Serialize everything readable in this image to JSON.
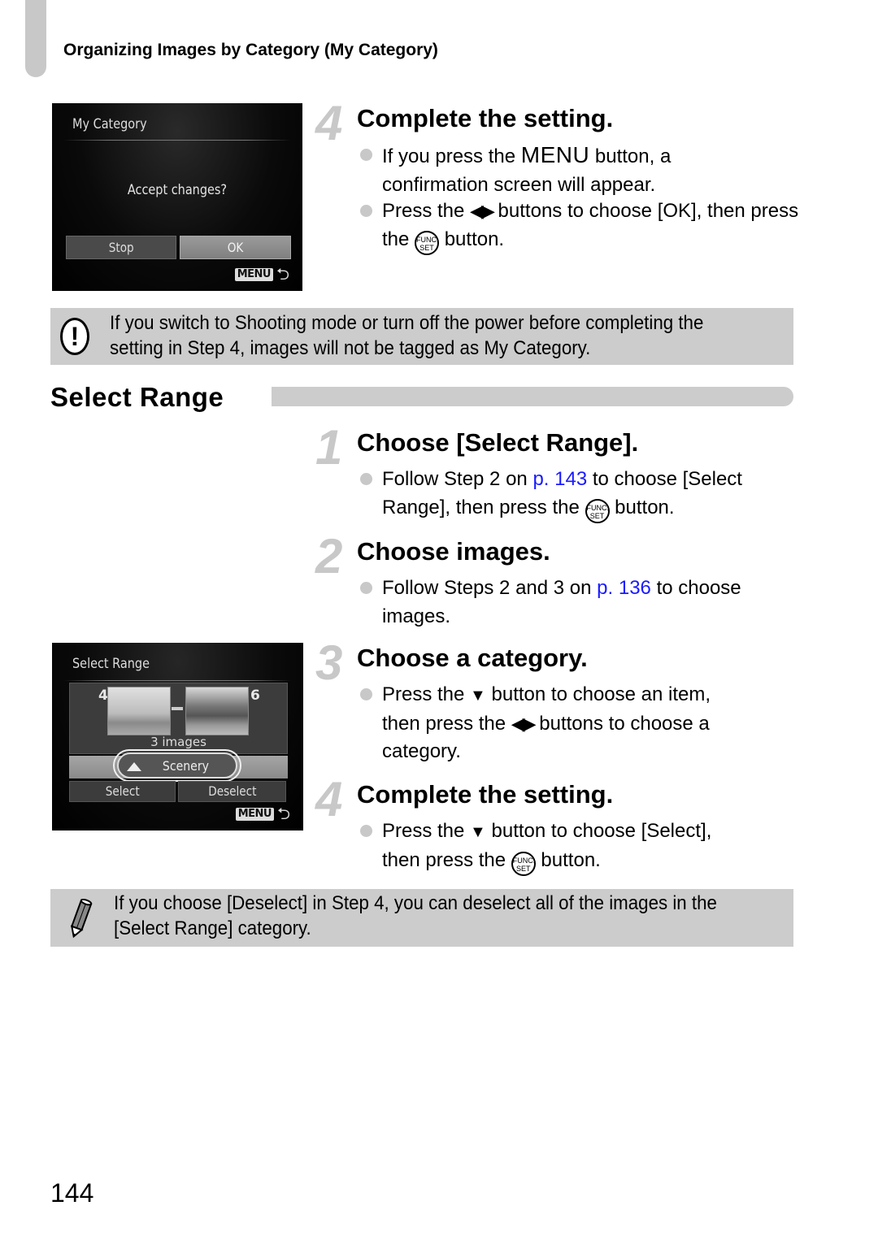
{
  "running_head": "Organizing Images by Category (My Category)",
  "camera_screen_1": {
    "title": "My Category",
    "message": "Accept changes?",
    "buttons": [
      "Stop",
      "OK"
    ],
    "selected_button": "OK",
    "menu_badge": "MENU",
    "back_icon": "return-arrow-icon"
  },
  "step_4a": {
    "number": "4",
    "title": "Complete the setting.",
    "bullets": [
      {
        "pre": "If you press the ",
        "icon": "MENU",
        "post": " button, a confirmation screen will appear."
      },
      {
        "pre": "Press the ",
        "icon": "left-right-buttons",
        "mid": " buttons to choose [OK], then press the ",
        "icon2": "FUNC./SET",
        "post": " button."
      }
    ]
  },
  "warning_note": {
    "icon": "caution-icon",
    "text_line1": "If you switch to Shooting mode or turn off the power before completing the",
    "text_line2": "setting in Step 4, images will not be tagged as My Category."
  },
  "section": {
    "title": "Select Range"
  },
  "step_1": {
    "number": "1",
    "title": "Choose [Select Range].",
    "bullet": {
      "pre": "Follow Step 2 on ",
      "link": "p. 143",
      "mid": " to choose [Select",
      "line2_pre": "Range], then press the ",
      "post": " button."
    }
  },
  "step_2": {
    "number": "2",
    "title": "Choose images.",
    "bullet": {
      "pre": "Follow Steps 2 and 3 on ",
      "link": "p. 136",
      "post": " to choose",
      "line2": "images."
    }
  },
  "camera_screen_2": {
    "title": "Select Range",
    "first_image_number": "4",
    "last_image_number": "6",
    "image_count": "3 images",
    "category": "Scenery",
    "category_icon": "scenery-icon",
    "buttons": [
      "Select",
      "Deselect"
    ],
    "menu_badge": "MENU"
  },
  "step_3": {
    "number": "3",
    "title": "Choose a category.",
    "bullet": {
      "pre": "Press the ",
      "mid1": " button to choose an item,",
      "line2_pre": "then press the ",
      "line2_post": " buttons to choose a",
      "line3": "category."
    }
  },
  "step_4b": {
    "number": "4",
    "title": "Complete the setting.",
    "bullet": {
      "pre": "Press the ",
      "mid": " button to choose [Select],",
      "line2_pre": "then press the ",
      "post": " button."
    }
  },
  "memo_note": {
    "icon": "pencil-icon",
    "text_line1": "If you choose [Deselect] in Step 4, you can deselect all of the images in the",
    "text_line2": "[Select Range] category."
  },
  "glyphs": {
    "func_top": "FUNC.",
    "func_bottom": "SET",
    "left_right": "◀▶",
    "down": "▼",
    "menu_word": "MENU",
    "back": "⮌",
    "exclaim": "!"
  },
  "page_number": "144",
  "colors": {
    "link": "#1a1aff",
    "tab_gray": "#c8c8c8",
    "note_bg": "#cccccc"
  }
}
